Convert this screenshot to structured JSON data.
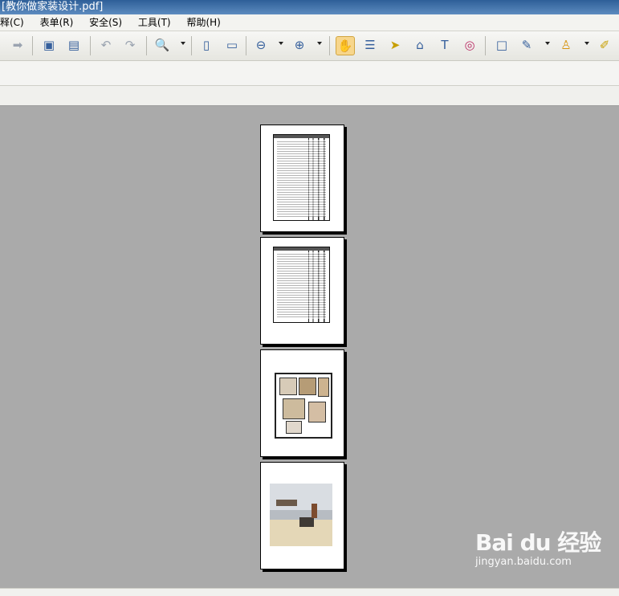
{
  "window": {
    "title": "[教你做家装设计.pdf]"
  },
  "menu": [
    {
      "label": "释(C)"
    },
    {
      "label": "表单(R)"
    },
    {
      "label": "安全(S)"
    },
    {
      "label": "工具(T)"
    },
    {
      "label": "帮助(H)"
    }
  ],
  "toolbar": {
    "icons": [
      "next-arrow-icon",
      "extract-page-icon",
      "insert-page-icon",
      "undo-icon",
      "redo-icon",
      "zoom-in-icon",
      "fit-page-icon",
      "fit-width-icon",
      "zoom-out-icon",
      "zoom-in-circle-icon",
      "hand-tool-icon",
      "select-text-icon",
      "select-arrow-icon",
      "binoculars-icon",
      "text-box-icon",
      "camera-icon",
      "window-icon",
      "pen-icon",
      "stamp-icon",
      "edit-icon"
    ]
  },
  "document": {
    "pages": [
      {
        "kind": "table"
      },
      {
        "kind": "table"
      },
      {
        "kind": "floor-plan"
      },
      {
        "kind": "render"
      }
    ]
  },
  "watermark": {
    "brand": "Bai du 经验",
    "url": "jingyan.baidu.com"
  }
}
